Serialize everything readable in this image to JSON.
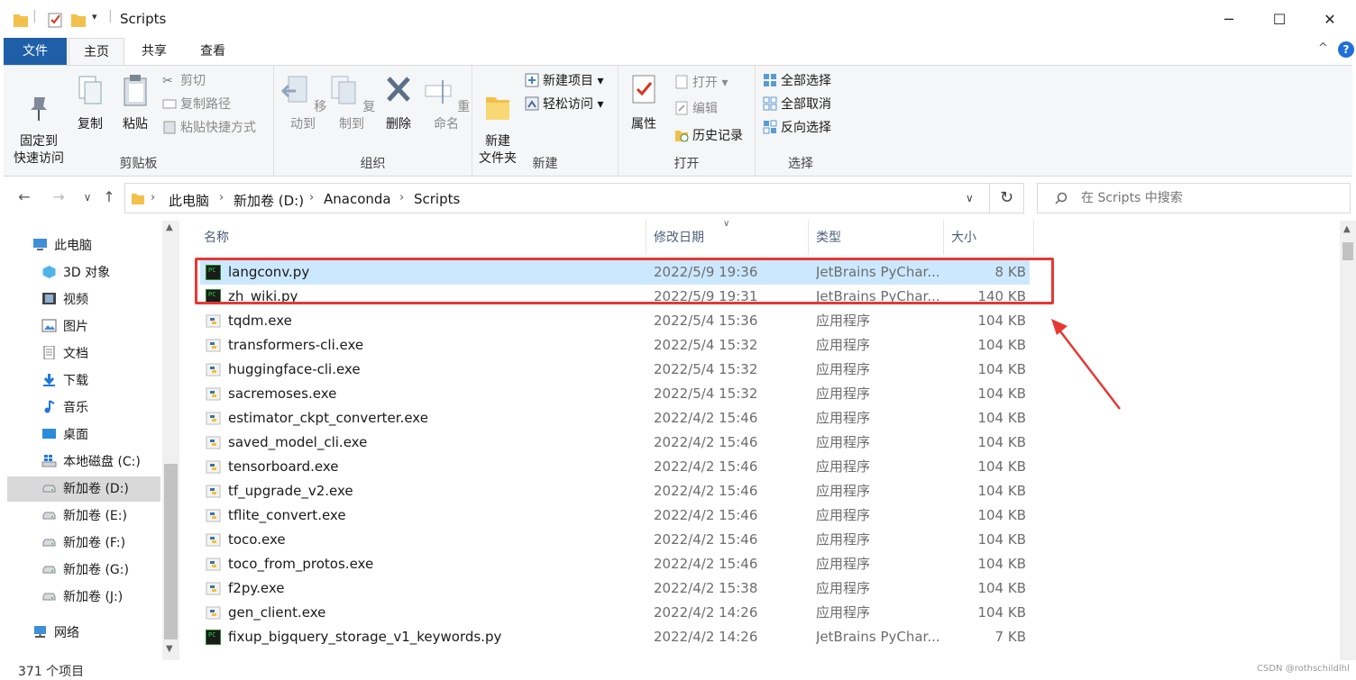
{
  "window": {
    "title": "Scripts",
    "minimize": "─",
    "maximize": "☐",
    "close": "✕"
  },
  "ribbon_tabs": [
    {
      "label": "文件"
    },
    {
      "label": "主页"
    },
    {
      "label": "共享"
    },
    {
      "label": "查看"
    }
  ],
  "ribbon": {
    "clipboard": {
      "label": "剪贴板",
      "pin": "固定到\n快速访问",
      "copy": "复制",
      "paste": "粘贴",
      "cut": "剪切",
      "copy_path": "复制路径",
      "paste_shortcut": "粘贴快捷方式"
    },
    "organize": {
      "label": "组织",
      "move_to": "移动到",
      "copy_to": "复制到",
      "delete": "删除",
      "rename": "重命名"
    },
    "new": {
      "label": "新建",
      "new_folder": "新建\n文件夹",
      "new_item": "新建项目",
      "easy_access": "轻松访问"
    },
    "open": {
      "label": "打开",
      "properties": "属性",
      "open": "打开",
      "edit": "编辑",
      "history": "历史记录"
    },
    "select": {
      "label": "选择",
      "select_all": "全部选择",
      "select_none": "全部取消",
      "invert": "反向选择"
    }
  },
  "address": {
    "crumbs": [
      "此电脑",
      "新加卷 (D:)",
      "Anaconda",
      "Scripts"
    ],
    "search_placeholder": "在 Scripts 中搜索"
  },
  "nav_tree": [
    {
      "label": "此电脑",
      "icon": "computer-icon"
    },
    {
      "label": "3D 对象",
      "icon": "3d-objects-icon"
    },
    {
      "label": "视频",
      "icon": "video-icon"
    },
    {
      "label": "图片",
      "icon": "pictures-icon"
    },
    {
      "label": "文档",
      "icon": "documents-icon"
    },
    {
      "label": "下载",
      "icon": "download-icon"
    },
    {
      "label": "音乐",
      "icon": "music-icon"
    },
    {
      "label": "桌面",
      "icon": "desktop-icon"
    },
    {
      "label": "本地磁盘 (C:)",
      "icon": "windows-drive-icon"
    },
    {
      "label": "新加卷 (D:)",
      "icon": "drive-icon"
    },
    {
      "label": "新加卷 (E:)",
      "icon": "drive-icon"
    },
    {
      "label": "新加卷 (F:)",
      "icon": "drive-icon"
    },
    {
      "label": "新加卷 (G:)",
      "icon": "drive-icon"
    },
    {
      "label": "新加卷 (J:)",
      "icon": "drive-icon"
    },
    {
      "label": "网络",
      "icon": "network-icon"
    }
  ],
  "columns": {
    "name": "名称",
    "date": "修改日期",
    "type": "类型",
    "size": "大小"
  },
  "files": [
    {
      "name": "langconv.py",
      "date": "2022/5/9 19:36",
      "type": "JetBrains PyChar...",
      "size": "8 KB",
      "icon": "pycharm-file-icon"
    },
    {
      "name": "zh_wiki.py",
      "date": "2022/5/9 19:31",
      "type": "JetBrains PyChar...",
      "size": "140 KB",
      "icon": "pycharm-file-icon"
    },
    {
      "name": "tqdm.exe",
      "date": "2022/5/4 15:36",
      "type": "应用程序",
      "size": "104 KB",
      "icon": "python-exe-icon"
    },
    {
      "name": "transformers-cli.exe",
      "date": "2022/5/4 15:32",
      "type": "应用程序",
      "size": "104 KB",
      "icon": "python-exe-icon"
    },
    {
      "name": "huggingface-cli.exe",
      "date": "2022/5/4 15:32",
      "type": "应用程序",
      "size": "104 KB",
      "icon": "python-exe-icon"
    },
    {
      "name": "sacremoses.exe",
      "date": "2022/5/4 15:32",
      "type": "应用程序",
      "size": "104 KB",
      "icon": "python-exe-icon"
    },
    {
      "name": "estimator_ckpt_converter.exe",
      "date": "2022/4/2 15:46",
      "type": "应用程序",
      "size": "104 KB",
      "icon": "python-exe-icon"
    },
    {
      "name": "saved_model_cli.exe",
      "date": "2022/4/2 15:46",
      "type": "应用程序",
      "size": "104 KB",
      "icon": "python-exe-icon"
    },
    {
      "name": "tensorboard.exe",
      "date": "2022/4/2 15:46",
      "type": "应用程序",
      "size": "104 KB",
      "icon": "python-exe-icon"
    },
    {
      "name": "tf_upgrade_v2.exe",
      "date": "2022/4/2 15:46",
      "type": "应用程序",
      "size": "104 KB",
      "icon": "python-exe-icon"
    },
    {
      "name": "tflite_convert.exe",
      "date": "2022/4/2 15:46",
      "type": "应用程序",
      "size": "104 KB",
      "icon": "python-exe-icon"
    },
    {
      "name": "toco.exe",
      "date": "2022/4/2 15:46",
      "type": "应用程序",
      "size": "104 KB",
      "icon": "python-exe-icon"
    },
    {
      "name": "toco_from_protos.exe",
      "date": "2022/4/2 15:46",
      "type": "应用程序",
      "size": "104 KB",
      "icon": "python-exe-icon"
    },
    {
      "name": "f2py.exe",
      "date": "2022/4/2 15:38",
      "type": "应用程序",
      "size": "104 KB",
      "icon": "python-exe-icon"
    },
    {
      "name": "gen_client.exe",
      "date": "2022/4/2 14:26",
      "type": "应用程序",
      "size": "104 KB",
      "icon": "python-exe-icon"
    },
    {
      "name": "fixup_bigquery_storage_v1_keywords.py",
      "date": "2022/4/2 14:26",
      "type": "JetBrains PyChar...",
      "size": "7 KB",
      "icon": "pycharm-file-icon"
    }
  ],
  "status": {
    "count": "371 个项目",
    "watermark": "CSDN @rothschildlhl"
  },
  "colors": {
    "accent": "#1e5fa8",
    "selection": "#cce8ff",
    "annotation": "#e53935"
  }
}
